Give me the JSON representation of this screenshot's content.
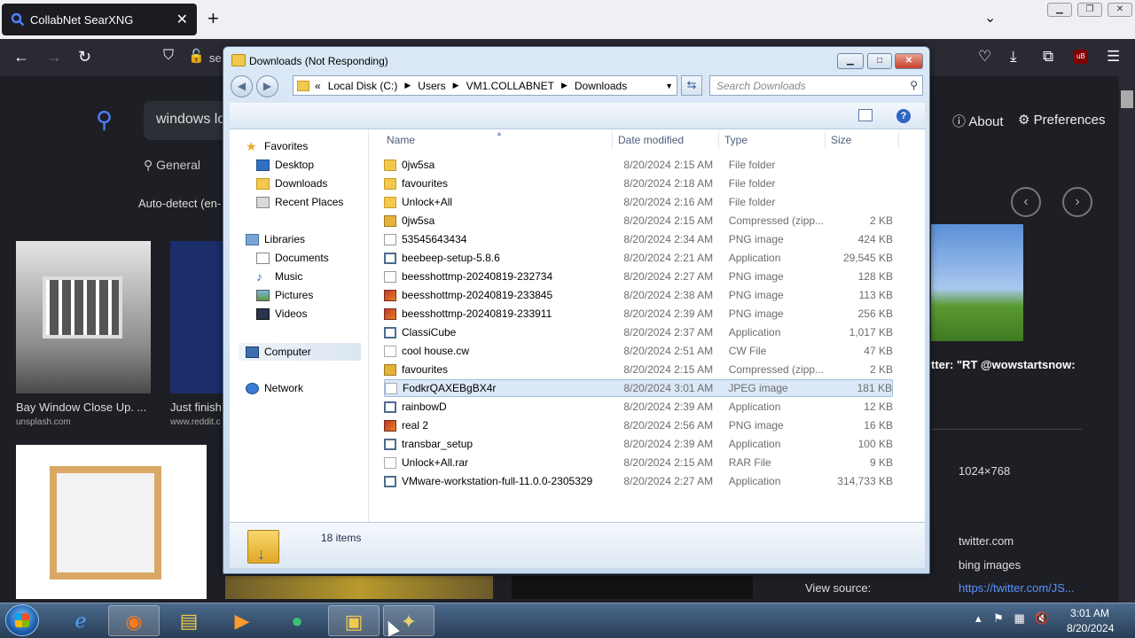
{
  "browser": {
    "tab_title": "CollabNet SearXNG",
    "tab_close": "✕",
    "new_tab": "+",
    "url_fragment": "se"
  },
  "searx": {
    "query": "windows lo",
    "category_general": "General",
    "autodetect": "Auto-detect (en-",
    "about": "About",
    "preferences": "Preferences",
    "results": [
      {
        "caption": "Bay Window Close Up. ...",
        "source": "unsplash.com"
      },
      {
        "caption": "Just finish",
        "source": "www.reddit.c"
      }
    ],
    "detail_title": "tter: \"RT @wowstartsnow:",
    "resolution": "1024×768",
    "site": "twitter.com",
    "engine": "bing images",
    "view_source_label": "View source:",
    "source_url": "https://twitter.com/JS..."
  },
  "explorer": {
    "title": "Downloads (Not Responding)",
    "address": {
      "prefix": "«",
      "crumbs": [
        "Local Disk (C:)",
        "Users",
        "VM1.COLLABNET",
        "Downloads"
      ]
    },
    "search_placeholder": "Search Downloads",
    "nav": {
      "favorites": "Favorites",
      "desktop": "Desktop",
      "downloads": "Downloads",
      "recent": "Recent Places",
      "libraries": "Libraries",
      "documents": "Documents",
      "music": "Music",
      "pictures": "Pictures",
      "videos": "Videos",
      "computer": "Computer",
      "network": "Network"
    },
    "columns": {
      "name": "Name",
      "date": "Date modified",
      "type": "Type",
      "size": "Size"
    },
    "files": [
      {
        "name": "0jw5sa",
        "date": "8/20/2024 2:15 AM",
        "type": "File folder",
        "size": "",
        "icon": "folder"
      },
      {
        "name": "favourites",
        "date": "8/20/2024 2:18 AM",
        "type": "File folder",
        "size": "",
        "icon": "folder"
      },
      {
        "name": "Unlock+All",
        "date": "8/20/2024 2:16 AM",
        "type": "File folder",
        "size": "",
        "icon": "folder"
      },
      {
        "name": "0jw5sa",
        "date": "8/20/2024 2:15 AM",
        "type": "Compressed (zipp...",
        "size": "2 KB",
        "icon": "zip"
      },
      {
        "name": "53545643434",
        "date": "8/20/2024 2:34 AM",
        "type": "PNG image",
        "size": "424 KB",
        "icon": "png"
      },
      {
        "name": "beebeep-setup-5.8.6",
        "date": "8/20/2024 2:21 AM",
        "type": "Application",
        "size": "29,545 KB",
        "icon": "app"
      },
      {
        "name": "beesshottmp-20240819-232734",
        "date": "8/20/2024 2:27 AM",
        "type": "PNG image",
        "size": "128 KB",
        "icon": "png"
      },
      {
        "name": "beesshottmp-20240819-233845",
        "date": "8/20/2024 2:38 AM",
        "type": "PNG image",
        "size": "113 KB",
        "icon": "imgc"
      },
      {
        "name": "beesshottmp-20240819-233911",
        "date": "8/20/2024 2:39 AM",
        "type": "PNG image",
        "size": "256 KB",
        "icon": "imgc"
      },
      {
        "name": "ClassiCube",
        "date": "8/20/2024 2:37 AM",
        "type": "Application",
        "size": "1,017 KB",
        "icon": "app"
      },
      {
        "name": "cool house.cw",
        "date": "8/20/2024 2:51 AM",
        "type": "CW File",
        "size": "47 KB",
        "icon": "doc"
      },
      {
        "name": "favourites",
        "date": "8/20/2024 2:15 AM",
        "type": "Compressed (zipp...",
        "size": "2 KB",
        "icon": "zip"
      },
      {
        "name": "FodkrQAXEBgBX4r",
        "date": "8/20/2024 3:01 AM",
        "type": "JPEG image",
        "size": "181 KB",
        "icon": "doc",
        "selected": true
      },
      {
        "name": "rainbowD",
        "date": "8/20/2024 2:39 AM",
        "type": "Application",
        "size": "12 KB",
        "icon": "app"
      },
      {
        "name": "real 2",
        "date": "8/20/2024 2:56 AM",
        "type": "PNG image",
        "size": "16 KB",
        "icon": "imgc"
      },
      {
        "name": "transbar_setup",
        "date": "8/20/2024 2:39 AM",
        "type": "Application",
        "size": "100 KB",
        "icon": "app"
      },
      {
        "name": "Unlock+All.rar",
        "date": "8/20/2024 2:15 AM",
        "type": "RAR File",
        "size": "9 KB",
        "icon": "doc"
      },
      {
        "name": "VMware-workstation-full-11.0.0-2305329",
        "date": "8/20/2024 2:27 AM",
        "type": "Application",
        "size": "314,733 KB",
        "icon": "app"
      }
    ],
    "item_count": "18 items"
  },
  "taskbar": {
    "time": "3:01 AM",
    "date": "8/20/2024"
  }
}
